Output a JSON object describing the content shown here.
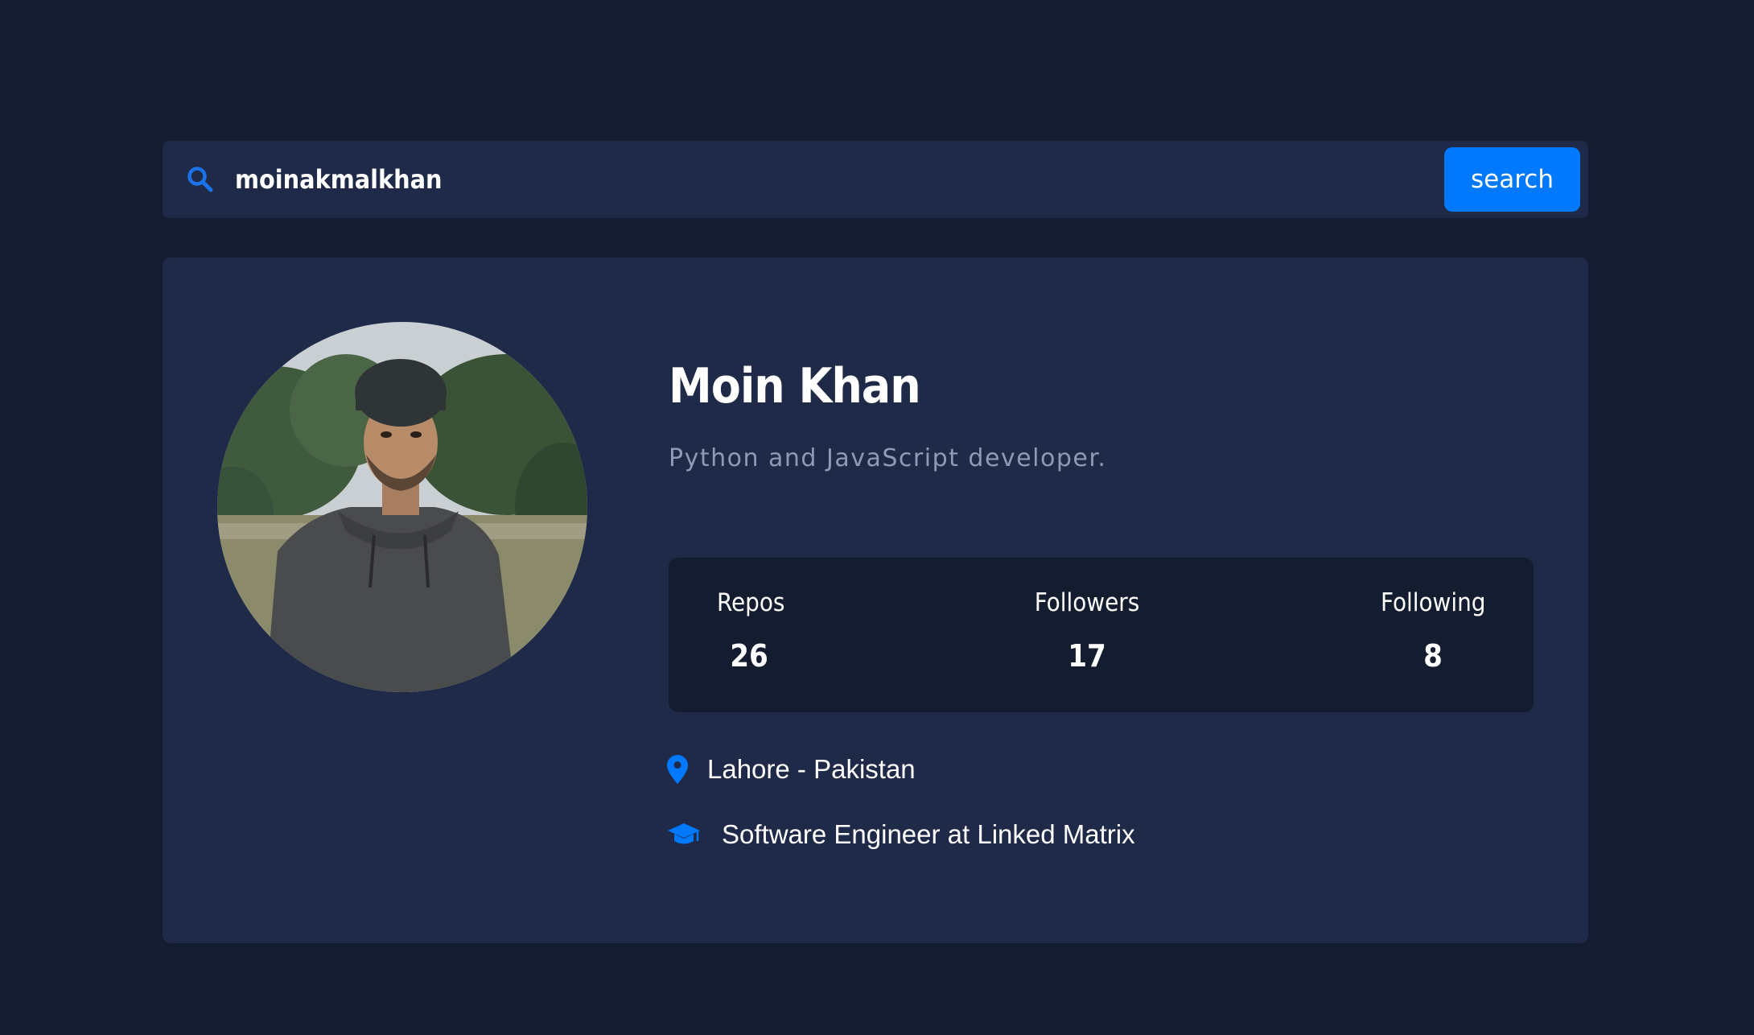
{
  "search": {
    "query": "moinakmalkhan",
    "button_label": "search",
    "icon": "search-icon"
  },
  "profile": {
    "avatar": "avatar-photo",
    "name": "Moin Khan",
    "bio": "Python and JavaScript developer.",
    "stats": {
      "repos": {
        "label": "Repos",
        "value": "26"
      },
      "followers": {
        "label": "Followers",
        "value": "17"
      },
      "following": {
        "label": "Following",
        "value": "8"
      }
    },
    "location": {
      "icon": "location-pin-icon",
      "text": "Lahore - Pakistan"
    },
    "work": {
      "icon": "graduation-cap-icon",
      "text": "Software Engineer at Linked Matrix"
    }
  },
  "colors": {
    "background": "#141c2f",
    "card": "#1f2a48",
    "accent": "#0079ff",
    "muted_text": "#8f9ab5",
    "text": "#ffffff"
  }
}
